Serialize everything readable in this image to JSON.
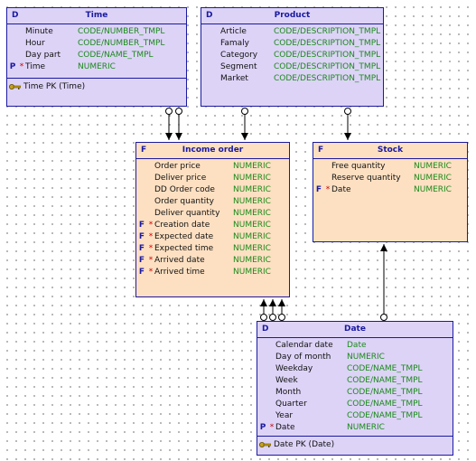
{
  "entities": {
    "time": {
      "type": "D",
      "title": "Time",
      "attrs": [
        {
          "flag": "",
          "req": "",
          "name": "Minute",
          "dtype": "CODE/NUMBER_TMPL"
        },
        {
          "flag": "",
          "req": "",
          "name": "Hour",
          "dtype": "CODE/NUMBER_TMPL"
        },
        {
          "flag": "",
          "req": "",
          "name": "Day part",
          "dtype": "CODE/NAME_TMPL"
        },
        {
          "flag": "P",
          "req": "*",
          "name": "Time",
          "dtype": "NUMERIC"
        }
      ],
      "key": "Time PK (Time)"
    },
    "product": {
      "type": "D",
      "title": "Product",
      "attrs": [
        {
          "flag": "",
          "req": "",
          "name": "Article",
          "dtype": "CODE/DESCRIPTION_TMPL"
        },
        {
          "flag": "",
          "req": "",
          "name": "Famaly",
          "dtype": "CODE/DESCRIPTION_TMPL"
        },
        {
          "flag": "",
          "req": "",
          "name": "Category",
          "dtype": "CODE/DESCRIPTION_TMPL"
        },
        {
          "flag": "",
          "req": "",
          "name": "Segment",
          "dtype": "CODE/DESCRIPTION_TMPL"
        },
        {
          "flag": "",
          "req": "",
          "name": "Market",
          "dtype": "CODE/DESCRIPTION_TMPL"
        }
      ]
    },
    "income_order": {
      "type": "F",
      "title": "Income order",
      "attrs": [
        {
          "flag": "",
          "req": "",
          "name": "Order price",
          "dtype": "NUMERIC"
        },
        {
          "flag": "",
          "req": "",
          "name": "Deliver price",
          "dtype": "NUMERIC"
        },
        {
          "flag": "",
          "req": "",
          "name": "DD Order code",
          "dtype": "NUMERIC"
        },
        {
          "flag": "",
          "req": "",
          "name": "Order quantity",
          "dtype": "NUMERIC"
        },
        {
          "flag": "",
          "req": "",
          "name": "Deliver quantity",
          "dtype": "NUMERIC"
        },
        {
          "flag": "F",
          "req": "*",
          "name": "Creation date",
          "dtype": "NUMERIC"
        },
        {
          "flag": "F",
          "req": "*",
          "name": "Expected date",
          "dtype": "NUMERIC"
        },
        {
          "flag": "F",
          "req": "*",
          "name": "Expected time",
          "dtype": "NUMERIC"
        },
        {
          "flag": "F",
          "req": "*",
          "name": "Arrived date",
          "dtype": "NUMERIC"
        },
        {
          "flag": "F",
          "req": "*",
          "name": "Arrived time",
          "dtype": "NUMERIC"
        }
      ]
    },
    "stock": {
      "type": "F",
      "title": "Stock",
      "attrs": [
        {
          "flag": "",
          "req": "",
          "name": "Free quantity",
          "dtype": "NUMERIC"
        },
        {
          "flag": "",
          "req": "",
          "name": "Reserve quantity",
          "dtype": "NUMERIC"
        },
        {
          "flag": "F",
          "req": "*",
          "name": "Date",
          "dtype": "NUMERIC"
        }
      ]
    },
    "date": {
      "type": "D",
      "title": "Date",
      "attrs": [
        {
          "flag": "",
          "req": "",
          "name": "Calendar date",
          "dtype": "Date"
        },
        {
          "flag": "",
          "req": "",
          "name": "Day of month",
          "dtype": "NUMERIC"
        },
        {
          "flag": "",
          "req": "",
          "name": "Weekday",
          "dtype": "CODE/NAME_TMPL"
        },
        {
          "flag": "",
          "req": "",
          "name": "Week",
          "dtype": "CODE/NAME_TMPL"
        },
        {
          "flag": "",
          "req": "",
          "name": "Month",
          "dtype": "CODE/NAME_TMPL"
        },
        {
          "flag": "",
          "req": "",
          "name": "Quarter",
          "dtype": "CODE/NAME_TMPL"
        },
        {
          "flag": "",
          "req": "",
          "name": "Year",
          "dtype": "CODE/NAME_TMPL"
        },
        {
          "flag": "P",
          "req": "*",
          "name": "Date",
          "dtype": "NUMERIC"
        }
      ],
      "key": "Date PK (Date)"
    }
  },
  "relationships": [
    {
      "from": "time",
      "to": "income_order"
    },
    {
      "from": "time",
      "to": "income_order"
    },
    {
      "from": "product",
      "to": "income_order"
    },
    {
      "from": "product",
      "to": "stock"
    },
    {
      "from": "date",
      "to": "income_order"
    },
    {
      "from": "date",
      "to": "income_order"
    },
    {
      "from": "date",
      "to": "income_order"
    },
    {
      "from": "date",
      "to": "stock"
    }
  ],
  "colors": {
    "dimension_fill": "#ddd3f7",
    "fact_fill": "#fde0c2",
    "border": "#1a1aa0",
    "datatype_text": "#1a8a1a",
    "required_mark": "#cc0000"
  }
}
